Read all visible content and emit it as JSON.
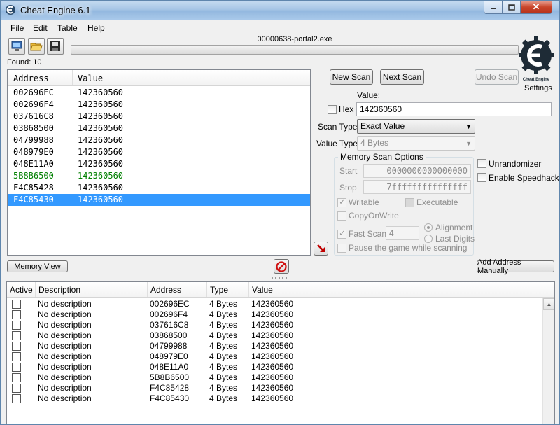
{
  "window": {
    "title": "Cheat Engine 6.1",
    "process": "00000638-portal2.exe"
  },
  "menu": [
    "File",
    "Edit",
    "Table",
    "Help"
  ],
  "found_label": "Found: 10",
  "settings_label": "Settings",
  "logo_text": "Cheat Engine",
  "results": {
    "headers": {
      "address": "Address",
      "value": "Value"
    },
    "rows": [
      {
        "address": "002696EC",
        "value": "142360560"
      },
      {
        "address": "002696F4",
        "value": "142360560"
      },
      {
        "address": "037616C8",
        "value": "142360560"
      },
      {
        "address": "03868500",
        "value": "142360560"
      },
      {
        "address": "04799988",
        "value": "142360560"
      },
      {
        "address": "048979E0",
        "value": "142360560"
      },
      {
        "address": "048E11A0",
        "value": "142360560"
      },
      {
        "address": "5B8B6500",
        "value": "142360560"
      },
      {
        "address": "F4C85428",
        "value": "142360560"
      },
      {
        "address": "F4C85430",
        "value": "142360560"
      }
    ]
  },
  "scan": {
    "new_scan": "New Scan",
    "next_scan": "Next Scan",
    "undo_scan": "Undo Scan",
    "value_label": "Value:",
    "hex_label": "Hex",
    "value": "142360560",
    "scan_type_label": "Scan Type",
    "scan_type": "Exact Value",
    "value_type_label": "Value Type",
    "value_type": "4 Bytes",
    "memory_options": "Memory Scan Options",
    "start_label": "Start",
    "start_value": "0000000000000000",
    "stop_label": "Stop",
    "stop_value": "7fffffffffffffff",
    "writable": "Writable",
    "executable": "Executable",
    "copy_on_write": "CopyOnWrite",
    "fast_scan": "Fast Scan",
    "fast_scan_value": "4",
    "alignment": "Alignment",
    "last_digits": "Last Digits",
    "pause_game": "Pause the game while scanning",
    "unrandomizer": "Unrandomizer",
    "speedhack": "Enable Speedhack"
  },
  "memory_view": "Memory View",
  "add_manually": "Add Address Manually",
  "addr_list": {
    "headers": {
      "active": "Active",
      "description": "Description",
      "address": "Address",
      "type": "Type",
      "value": "Value"
    },
    "rows": [
      {
        "description": "No description",
        "address": "002696EC",
        "type": "4 Bytes",
        "value": "142360560"
      },
      {
        "description": "No description",
        "address": "002696F4",
        "type": "4 Bytes",
        "value": "142360560"
      },
      {
        "description": "No description",
        "address": "037616C8",
        "type": "4 Bytes",
        "value": "142360560"
      },
      {
        "description": "No description",
        "address": "03868500",
        "type": "4 Bytes",
        "value": "142360560"
      },
      {
        "description": "No description",
        "address": "04799988",
        "type": "4 Bytes",
        "value": "142360560"
      },
      {
        "description": "No description",
        "address": "048979E0",
        "type": "4 Bytes",
        "value": "142360560"
      },
      {
        "description": "No description",
        "address": "048E11A0",
        "type": "4 Bytes",
        "value": "142360560"
      },
      {
        "description": "No description",
        "address": "5B8B6500",
        "type": "4 Bytes",
        "value": "142360560"
      },
      {
        "description": "No description",
        "address": "F4C85428",
        "type": "4 Bytes",
        "value": "142360560"
      },
      {
        "description": "No description",
        "address": "F4C85430",
        "type": "4 Bytes",
        "value": "142360560"
      }
    ]
  }
}
